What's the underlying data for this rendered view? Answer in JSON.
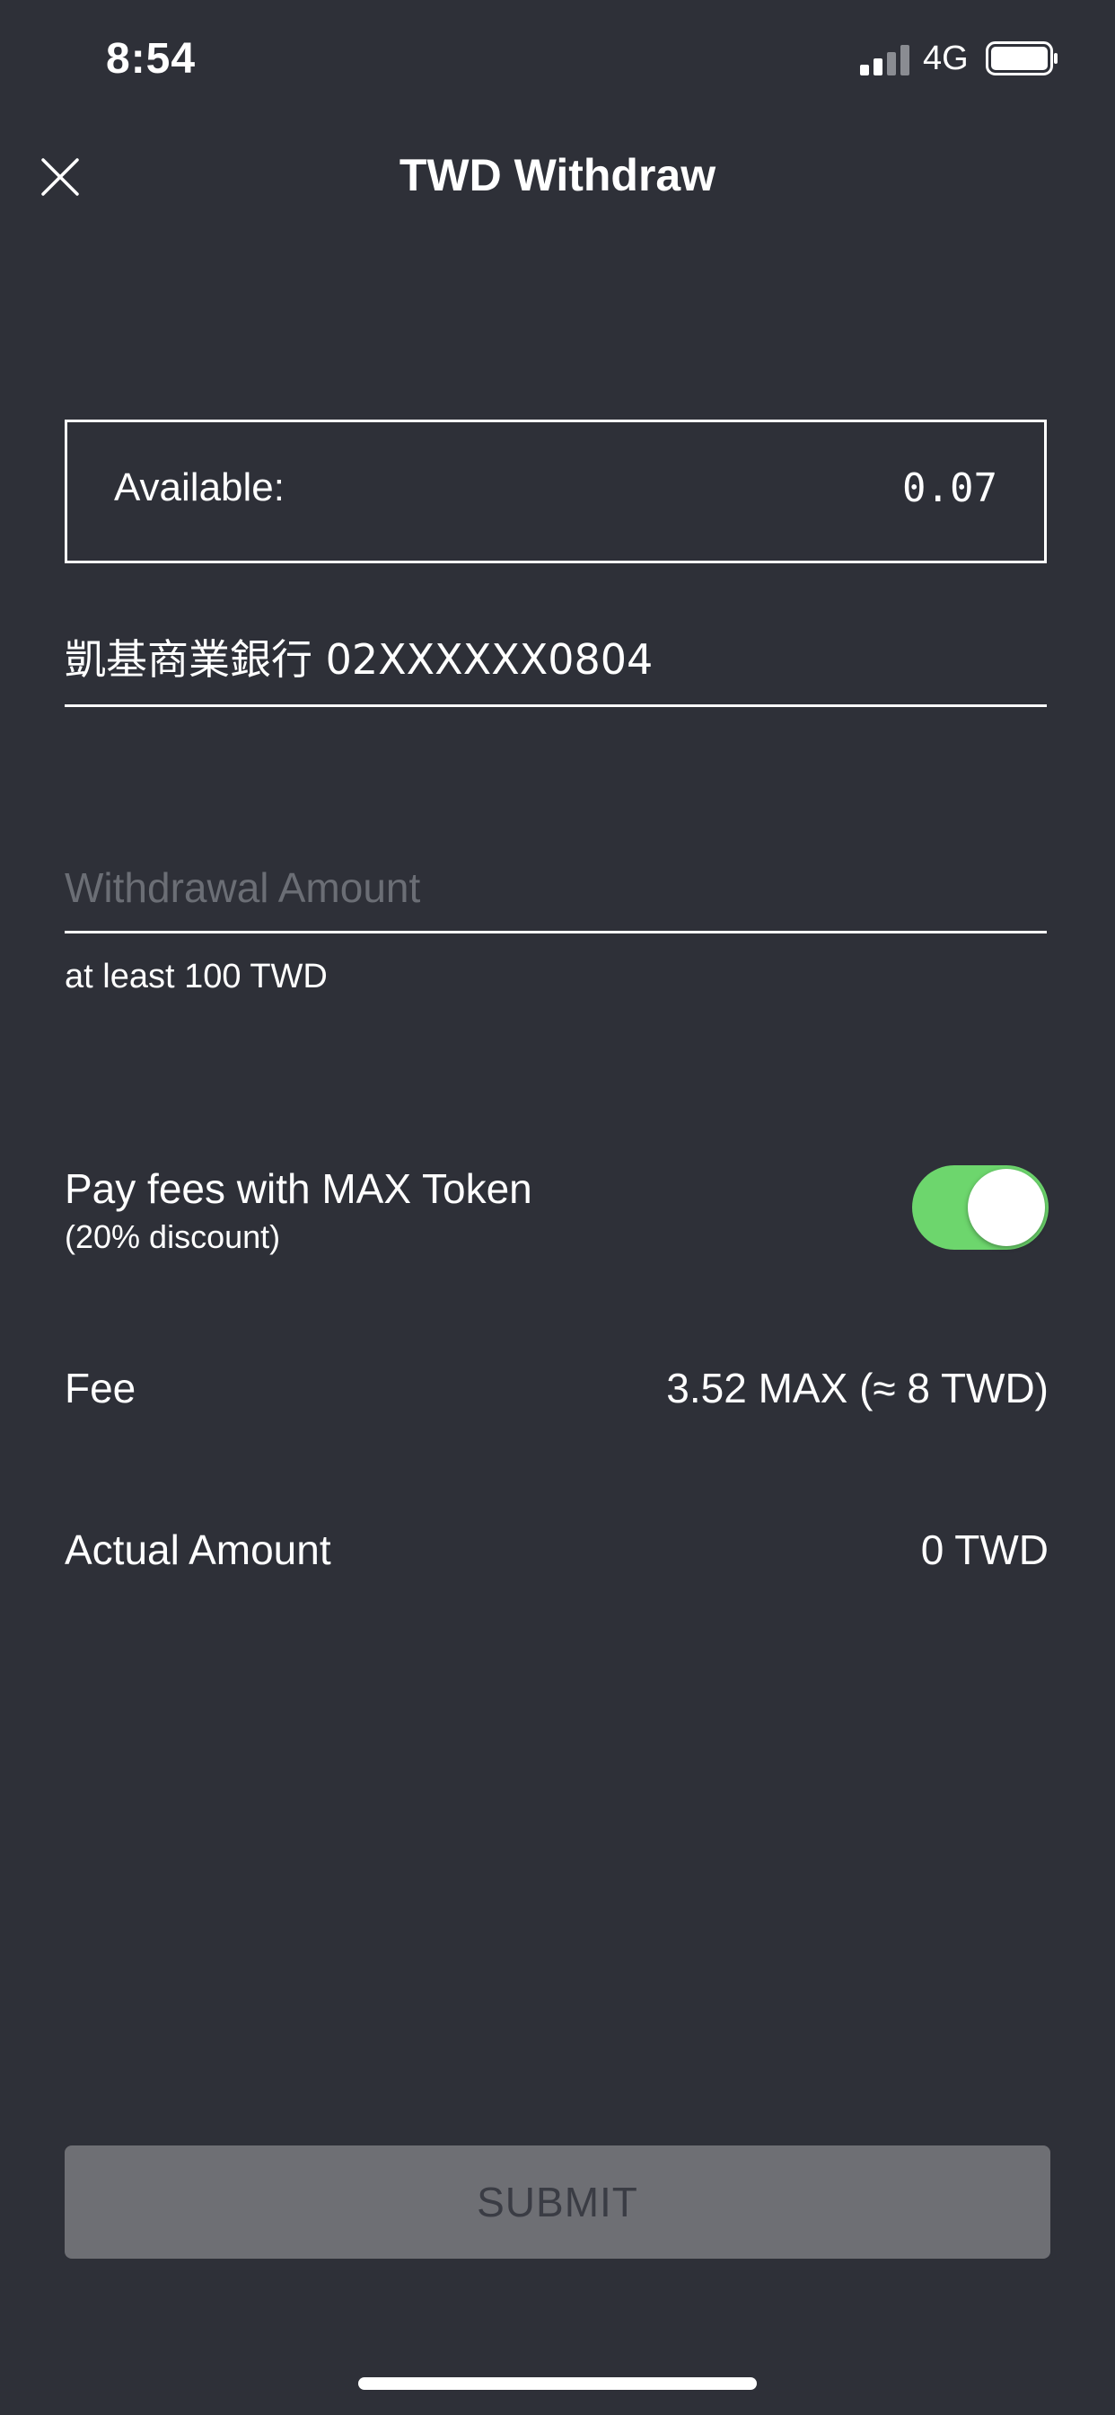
{
  "status_bar": {
    "time": "8:54",
    "network": "4G",
    "signal_icon": "signal-bars-icon",
    "battery_icon": "battery-icon"
  },
  "header": {
    "title": "TWD Withdraw",
    "close_icon": "close-icon"
  },
  "available": {
    "label": "Available:",
    "value": "0.07"
  },
  "bank_account": {
    "value": "凱基商業銀行 02XXXXXX0804"
  },
  "withdrawal": {
    "placeholder": "Withdrawal Amount",
    "value": "",
    "hint": "at least 100 TWD"
  },
  "pay_fees": {
    "label": "Pay fees with MAX Token",
    "sublabel": "(20% discount)",
    "enabled": true
  },
  "fee": {
    "label": "Fee",
    "value": "3.52 MAX (≈  8 TWD)"
  },
  "actual_amount": {
    "label": "Actual Amount",
    "value": "0 TWD"
  },
  "submit": {
    "label": "SUBMIT"
  },
  "colors": {
    "background": "#2e3038",
    "toggle_on": "#6dd66d",
    "submit_disabled": "#6e6f74",
    "placeholder": "#6b6e75"
  }
}
